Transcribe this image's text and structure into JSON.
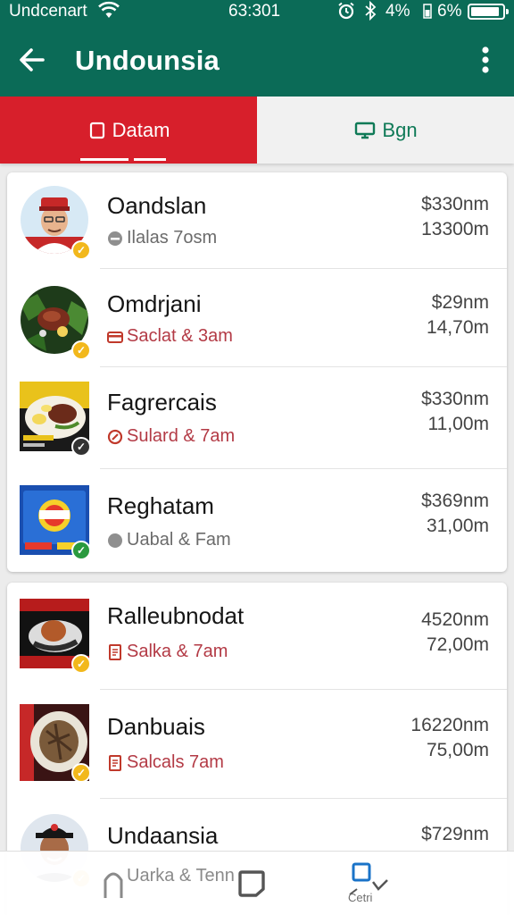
{
  "status_bar": {
    "carrier": "Undcenart",
    "time": "63:301",
    "battery_pct_1": "4%",
    "battery_pct_2": "6%",
    "battery_level": 0.9
  },
  "app_bar": {
    "title": "Undounsia",
    "back_icon": "arrow-left-icon",
    "menu_icon": "more-vert-icon"
  },
  "tabs": [
    {
      "label": "Datam",
      "icon": "square-icon",
      "active": true
    },
    {
      "label": "Bgn",
      "icon": "monitor-icon",
      "active": false
    }
  ],
  "colors": {
    "primary": "#0b6b57",
    "tab_active": "#d71f2b",
    "tab_inactive_text": "#0f7a57",
    "badge_yellow": "#f2b81c",
    "badge_dark": "#333333",
    "badge_green": "#2a9a3e"
  },
  "list_group_1": [
    {
      "name": "Oandslan",
      "subtitle": "Ilalas 7osm",
      "price": "$330nm",
      "amount": "13300m",
      "sub_icon": "circle-icon"
    },
    {
      "name": "Omdrjani",
      "subtitle": "Saclat & 3am",
      "price": "$29nm",
      "amount": "14,70m",
      "sub_icon": "card-icon"
    },
    {
      "name": "Fagrercais",
      "subtitle": "Sulard & 7am",
      "price": "$330nm",
      "amount": "11,00m",
      "sub_icon": "tag-icon"
    },
    {
      "name": "Reghatam",
      "subtitle": "Uabal & Fam",
      "price": "$369nm",
      "amount": "31,00m",
      "sub_icon": "circle-icon"
    }
  ],
  "list_group_2": [
    {
      "name": "Ralleubnodat",
      "subtitle": "Salka & 7am",
      "price": "4520nm",
      "amount": "72,00m",
      "sub_icon": "receipt-icon"
    },
    {
      "name": "Danbuais",
      "subtitle": "Salcals 7am",
      "price": "16220nm",
      "amount": "75,00m",
      "sub_icon": "receipt-icon"
    },
    {
      "name": "Undaansia",
      "subtitle": "",
      "price": "$729nm",
      "amount": "",
      "sub_icon": ""
    }
  ],
  "bottom_nav": {
    "label_1": "Uarka & Tenn",
    "label_2": "Cetri"
  }
}
